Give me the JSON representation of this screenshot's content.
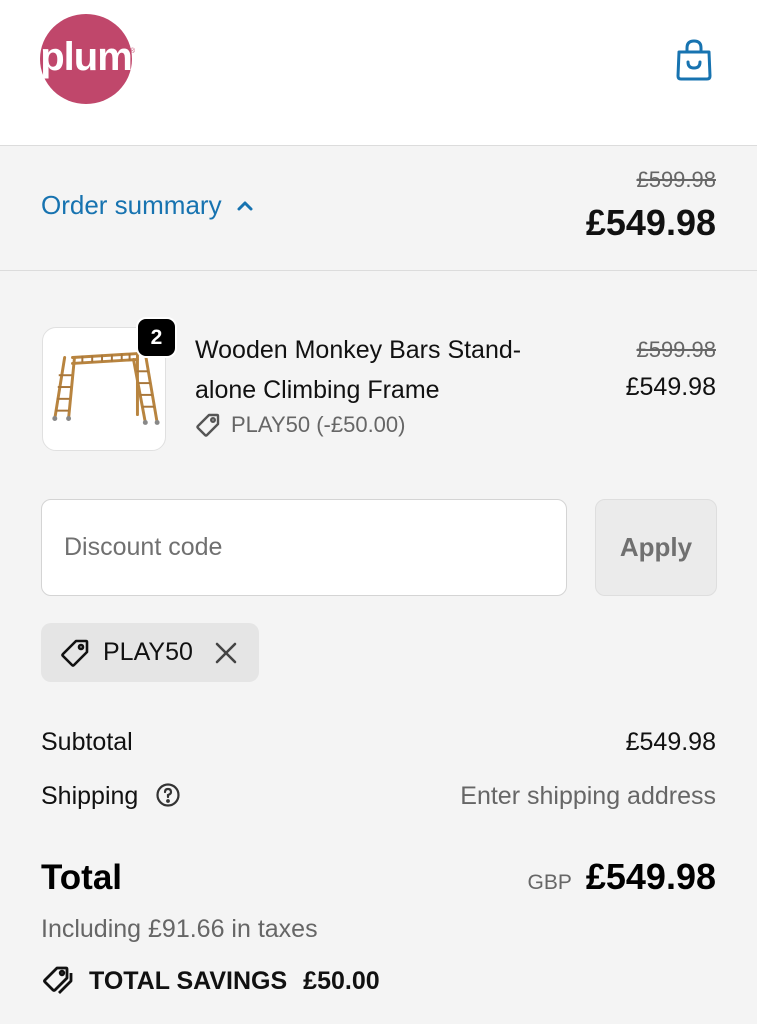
{
  "brand": {
    "logo_text": "plum",
    "logo_tm": "®",
    "color": "#c0476b"
  },
  "accent_color": "#1773b0",
  "header": {
    "cart_icon": "shopping-bag-icon"
  },
  "summary": {
    "toggle_label": "Order summary",
    "toggle_icon": "chevron-up-icon",
    "original_total": "£599.98",
    "total": "£549.98"
  },
  "line_item": {
    "title": "Wooden Monkey Bars Stand-alone Climbing Frame",
    "quantity": "2",
    "discount_label": "PLAY50 (-£50.00)",
    "original_price": "£599.98",
    "price": "£549.98",
    "image_icon": "climbing-frame-image"
  },
  "discount": {
    "placeholder": "Discount code",
    "apply_label": "Apply",
    "applied_code": "PLAY50"
  },
  "totals": {
    "subtotal_label": "Subtotal",
    "subtotal_value": "£549.98",
    "shipping_label": "Shipping",
    "shipping_value": "Enter shipping address",
    "total_label": "Total",
    "currency": "GBP",
    "total_value": "£549.98",
    "taxes_note": "Including £91.66 in taxes",
    "savings_label": "TOTAL SAVINGS",
    "savings_value": "£50.00"
  }
}
